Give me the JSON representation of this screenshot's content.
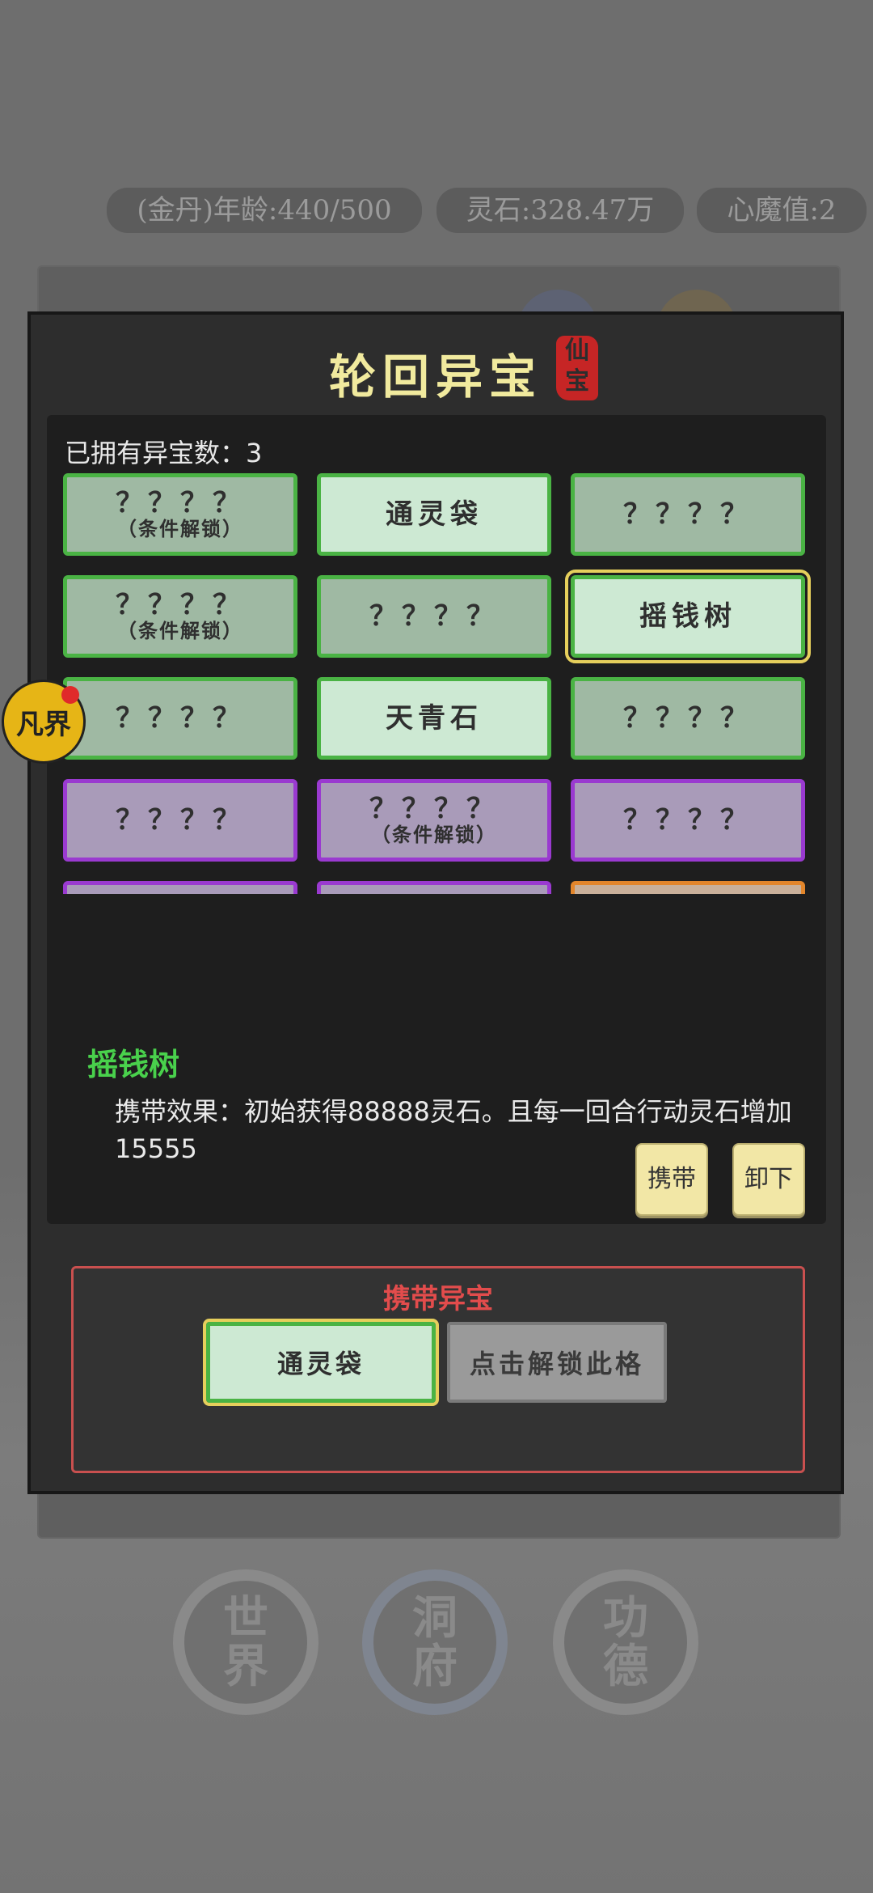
{
  "stats": {
    "age": "(金丹)年龄:440/500",
    "spirit_stone": "灵石:328.47万",
    "demon": "心魔值:2"
  },
  "modal": {
    "title": "轮回异宝",
    "seal": "仙宝",
    "owned_label": "已拥有异宝数：3"
  },
  "grid": [
    {
      "text": "？？？？",
      "cond": "（条件解锁）",
      "rarity": "green"
    },
    {
      "text": "通灵袋",
      "cond": "",
      "rarity": "green-known"
    },
    {
      "text": "？？？？",
      "cond": "",
      "rarity": "green"
    },
    {
      "text": "？？？？",
      "cond": "（条件解锁）",
      "rarity": "green"
    },
    {
      "text": "？？？？",
      "cond": "",
      "rarity": "green"
    },
    {
      "text": "摇钱树",
      "cond": "",
      "rarity": "green-selected"
    },
    {
      "text": "？？？？",
      "cond": "",
      "rarity": "green"
    },
    {
      "text": "天青石",
      "cond": "",
      "rarity": "green-known"
    },
    {
      "text": "？？？？",
      "cond": "",
      "rarity": "green"
    },
    {
      "text": "？？？？",
      "cond": "",
      "rarity": "purple"
    },
    {
      "text": "？？？？",
      "cond": "（条件解锁）",
      "rarity": "purple"
    },
    {
      "text": "？？？？",
      "cond": "",
      "rarity": "purple"
    },
    {
      "text": "？？？？",
      "cond": "",
      "rarity": "purple"
    },
    {
      "text": "？？？？",
      "cond": "",
      "rarity": "purple"
    },
    {
      "text": "？？？？",
      "cond": "",
      "rarity": "orange"
    },
    {
      "text": "",
      "cond": "",
      "rarity": "orange"
    },
    {
      "text": "",
      "cond": "",
      "rarity": "orange"
    },
    {
      "text": "",
      "cond": "",
      "rarity": "orange"
    }
  ],
  "detail": {
    "name": "摇钱树",
    "effect": "携带效果：初始获得88888灵石。且每一回合行动灵石增加15555"
  },
  "buttons": {
    "carry": "携带",
    "unload": "卸下"
  },
  "carry_panel": {
    "title": "携带异宝",
    "slot1": "通灵袋",
    "slot2": "点击解锁此格"
  },
  "side_badge": "凡界",
  "nav": {
    "world": [
      "世",
      "界"
    ],
    "cave": [
      "洞",
      "府"
    ],
    "merit": [
      "功",
      "德"
    ]
  },
  "colors": {
    "green_border": "#4ab344",
    "purple_border": "#9a3ad0",
    "orange_border": "#e3862b",
    "title_gold": "#f1ea9e",
    "carry_red": "#e24c4c"
  }
}
